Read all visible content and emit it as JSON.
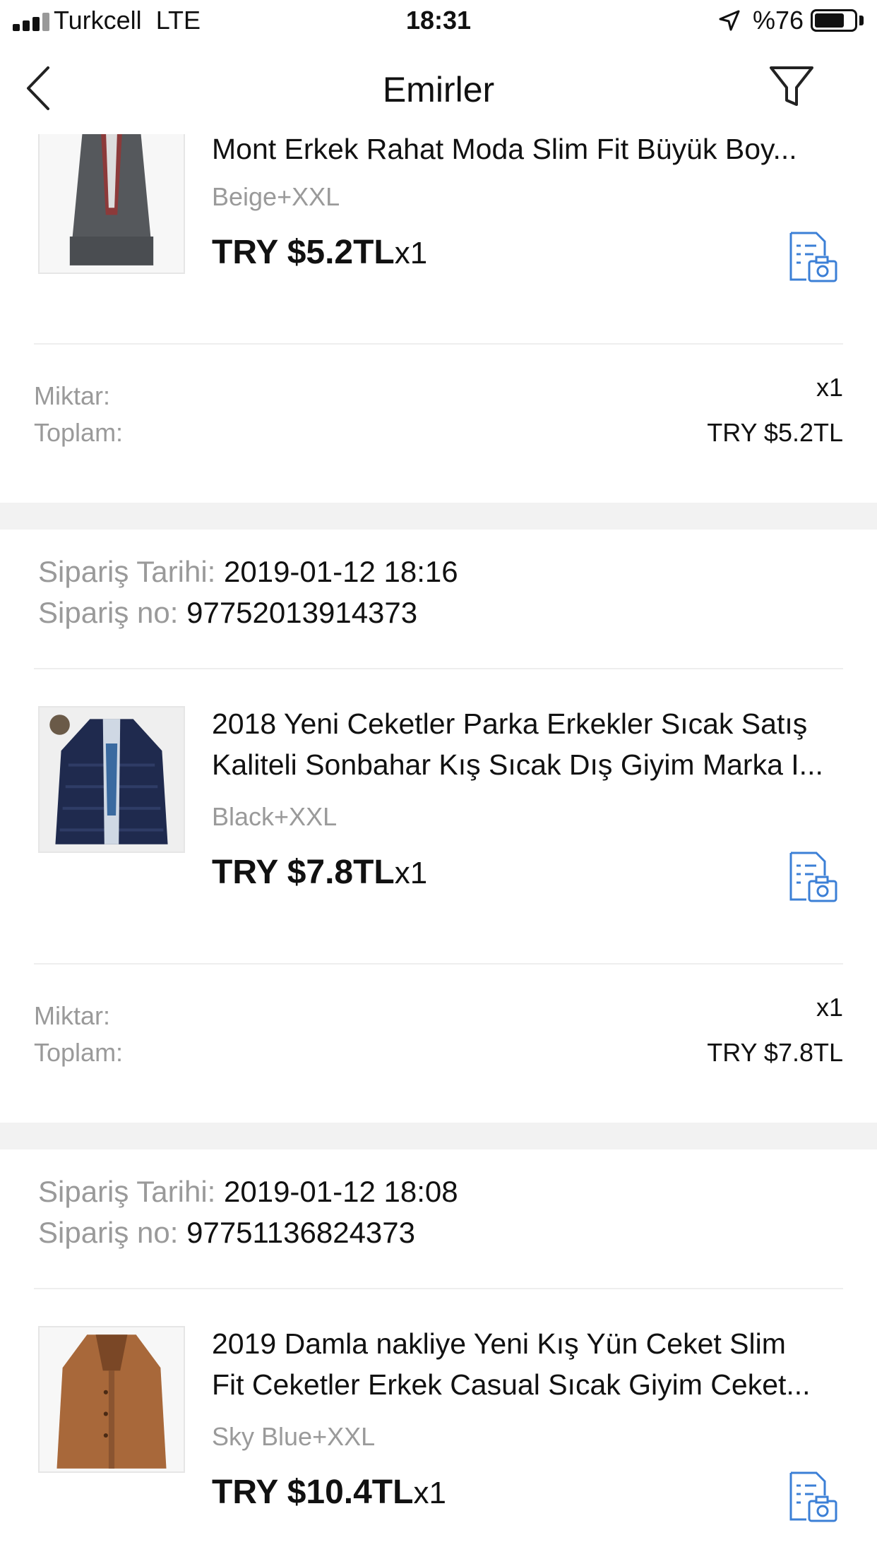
{
  "status_bar": {
    "carrier": "Turkcell",
    "network": "LTE",
    "time": "18:31",
    "battery_pct": "%76",
    "battery_level": 0.76
  },
  "nav": {
    "title": "Emirler"
  },
  "labels": {
    "quantity": "Miktar:",
    "total": "Toplam:",
    "order_date": "Sipariş Tarihi: ",
    "order_no": "Sipariş no: "
  },
  "orders": [
    {
      "product": {
        "title_lines": [
          "Mont Erkek Rahat Moda Slim Fit Büyük Boy..."
        ],
        "variant": "Beige+XXL",
        "price": "TRY $5.2TL",
        "qty": "x1",
        "image": "grey-wool-coat"
      },
      "summary": {
        "quantity": "x1",
        "total": "TRY $5.2TL"
      }
    },
    {
      "date": "2019-01-12 18:16",
      "order_no": "97752013914373",
      "product": {
        "title_lines": [
          "2018 Yeni Ceketler Parka Erkekler Sıcak Satış",
          "Kaliteli Sonbahar Kış Sıcak Dış Giyim Marka I..."
        ],
        "variant": "Black+XXL",
        "price": "TRY $7.8TL",
        "qty": "x1",
        "image": "navy-puffer-jacket"
      },
      "summary": {
        "quantity": "x1",
        "total": "TRY $7.8TL"
      }
    },
    {
      "date": "2019-01-12 18:08",
      "order_no": "97751136824373",
      "product": {
        "title_lines": [
          "2019 Damla nakliye Yeni Kış Yün Ceket Slim",
          "Fit Ceketler Erkek Casual Sıcak Giyim Ceket..."
        ],
        "variant": "Sky Blue+XXL",
        "price": "TRY $10.4TL",
        "qty": "x1",
        "image": "camel-wool-coat"
      }
    }
  ],
  "icons": {
    "back": "chevron-left-icon",
    "filter": "filter-icon",
    "review": "photo-review-icon",
    "location": "location-arrow-icon"
  },
  "colors": {
    "accent": "#3b7fd6",
    "muted_text": "#9a9a9a",
    "separator": "#f2f2f2"
  }
}
